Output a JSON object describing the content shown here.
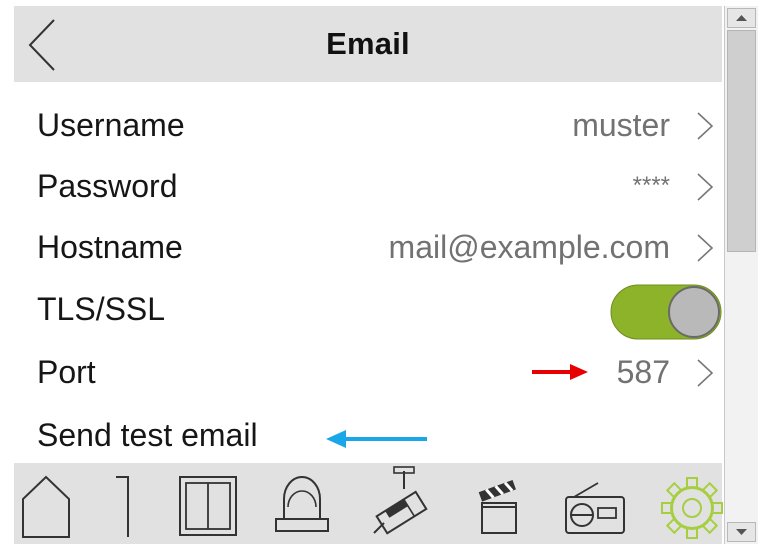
{
  "header": {
    "title": "Email",
    "back_icon": "chevron-left-icon"
  },
  "settings": {
    "rows": [
      {
        "label": "Username",
        "value": "muster"
      },
      {
        "label": "Password",
        "value": "****"
      },
      {
        "label": "Hostname",
        "value": "mail@example.com"
      },
      {
        "label": "TLS/SSL",
        "toggle_on": true
      },
      {
        "label": "Port",
        "value": "587"
      },
      {
        "label": "Send test email"
      }
    ]
  },
  "annotations": {
    "red_arrow_color": "#e80000",
    "blue_arrow_color": "#1aa7ea"
  },
  "toggle": {
    "on_color": "#8db32a",
    "knob_color": "#b9b9b9"
  },
  "bottom_nav": {
    "tabs": [
      {
        "icon": "home-icon"
      },
      {
        "icon": "door-icon"
      },
      {
        "icon": "window-icon"
      },
      {
        "icon": "alarm-bell-icon"
      },
      {
        "icon": "camera-icon"
      },
      {
        "icon": "clapperboard-icon"
      },
      {
        "icon": "radio-icon"
      },
      {
        "icon": "gear-icon",
        "active": true
      }
    ],
    "active_color": "#a6cf3f"
  }
}
